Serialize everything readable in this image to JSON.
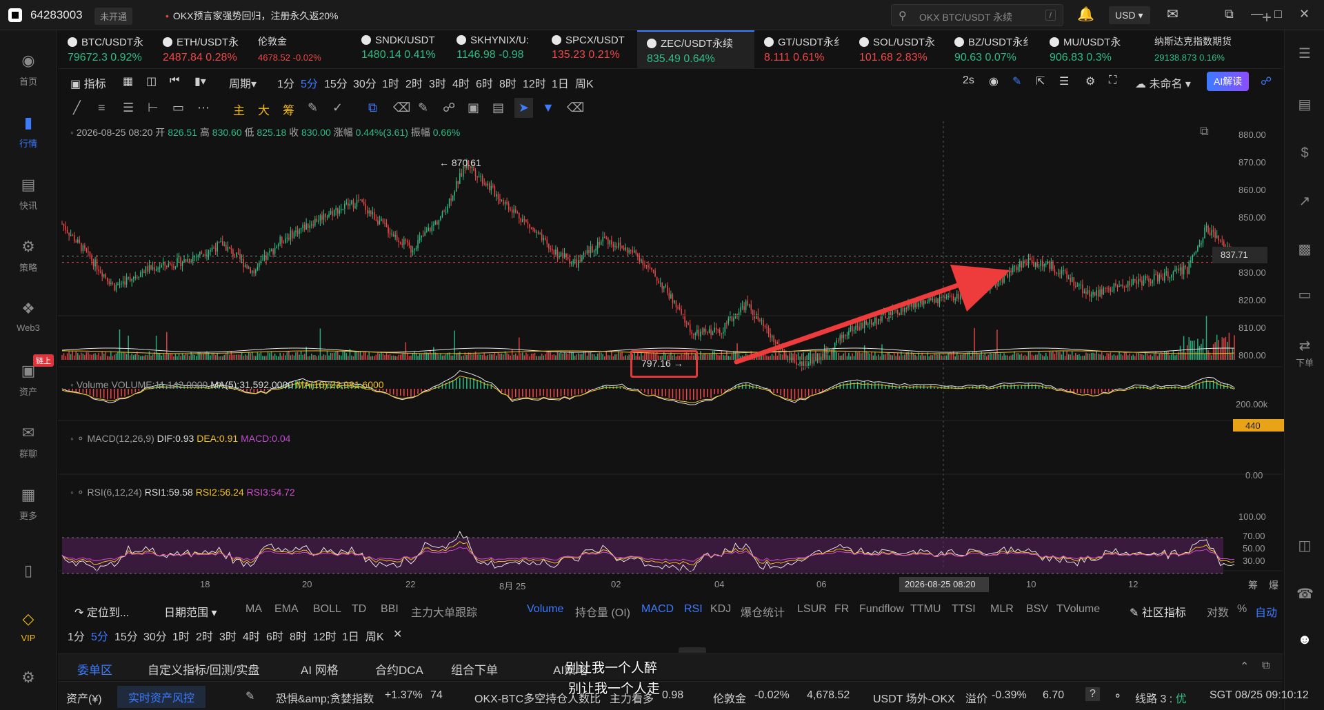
{
  "titlebar": {
    "uid": "64283003",
    "status": "未开通",
    "notice": "OKX预言家强势回归，注册永久返20%",
    "search_placeholder": "OKX BTC/USDT 永续",
    "search_shortcut": "/",
    "currency": "USD"
  },
  "sidebar": {
    "items": [
      {
        "label": "首页",
        "icon": "home-icon"
      },
      {
        "label": "行情",
        "icon": "market-icon"
      },
      {
        "label": "快讯",
        "icon": "news-icon"
      },
      {
        "label": "策略",
        "icon": "strategy-icon"
      },
      {
        "label": "Web3",
        "icon": "web3-icon"
      },
      {
        "label": "资产",
        "icon": "wallet-icon"
      },
      {
        "label": "群聊",
        "icon": "chat-icon"
      },
      {
        "label": "更多",
        "icon": "more-icon"
      },
      {
        "label": "VIP",
        "icon": "vip-icon"
      }
    ],
    "asset_badge": "链上"
  },
  "tabs": [
    {
      "name": "BTC/USDT永",
      "price": "79672.3",
      "change": "0.92%",
      "dir": "up"
    },
    {
      "name": "ETH/USDT永",
      "price": "2487.84",
      "change": "0.28%",
      "dir": "dn"
    },
    {
      "name": "伦敦金",
      "price": "4678.52",
      "change": "-0.02%",
      "dir": "dn",
      "small": true
    },
    {
      "name": "SNDK/USDT",
      "price": "1480.14",
      "change": "0.41%",
      "dir": "up"
    },
    {
      "name": "SKHYNIX/U:",
      "price": "1146.98",
      "change": "-0.98",
      "dir": "up"
    },
    {
      "name": "SPCX/USDT",
      "price": "135.23",
      "change": "0.21%",
      "dir": "dn"
    },
    {
      "name": "ZEC/USDT永续",
      "price": "835.49",
      "change": "0.64%",
      "dir": "up",
      "active": true
    },
    {
      "name": "GT/USDT永纟",
      "price": "8.111",
      "change": "0.61%",
      "dir": "dn"
    },
    {
      "name": "SOL/USDT永",
      "price": "101.68",
      "change": "2.83%",
      "dir": "dn"
    },
    {
      "name": "BZ/USDT永纟",
      "price": "90.63",
      "change": "0.07%",
      "dir": "up"
    },
    {
      "name": "MU/USDT永",
      "price": "906.83",
      "change": "0.3%",
      "dir": "up"
    },
    {
      "name": "纳斯达克指数期货",
      "price": "29138.873",
      "change": "0.16%",
      "dir": "up",
      "small": true
    }
  ],
  "toolbar": {
    "indicator": "指标",
    "period_label": "周期",
    "periods": [
      "1分",
      "5分",
      "15分",
      "30分",
      "1时",
      "2时",
      "3时",
      "4时",
      "6时",
      "8时",
      "12时",
      "1日",
      "周K"
    ],
    "selected_period": "5分",
    "refresh": "2s",
    "layout_name": "未命名",
    "ai_label": "AI解读"
  },
  "drawbar": {
    "zh_tools": [
      "主",
      "大",
      "筹"
    ]
  },
  "chart": {
    "ohlc_line": {
      "date": "2026-08-25 08:20",
      "open_label": "开",
      "open": "826.51",
      "high_label": "高",
      "high": "830.60",
      "low_label": "低",
      "low": "825.18",
      "close_label": "收",
      "close": "830.00",
      "chg_label": "涨幅",
      "chg": "0.44%(3.61)",
      "amp_label": "振幅",
      "amp": "0.66%"
    },
    "high_mark": "870.61",
    "low_mark": "797.16",
    "current_price": "837.71",
    "price_ticks": [
      "880.00",
      "870.00",
      "860.00",
      "850.00",
      "840.00",
      "830.00",
      "820.00",
      "810.00",
      "800.00"
    ],
    "volume": {
      "title": "Volume",
      "vol": "VOLUME:11,142.0000",
      "ma5": "MA(5):31,592.0000",
      "ma10": "MA(10):23,981.6000",
      "tick": "200.00k",
      "current": "440"
    },
    "macd": {
      "title": "MACD(12,26,9)",
      "dif": "DIF:0.93",
      "dea": "DEA:0.91",
      "macd": "MACD:0.04",
      "tick": "0.00"
    },
    "rsi": {
      "title": "RSI(6,12,24)",
      "rsi1": "RSI1:59.58",
      "rsi2": "RSI2:56.24",
      "rsi3": "RSI3:54.72",
      "ticks": [
        "100.00",
        "70.00",
        "50.00",
        "30.00"
      ]
    },
    "time_ticks": [
      "18",
      "20",
      "22",
      "8月 25",
      "02",
      "04",
      "06",
      "08",
      "10",
      "12"
    ],
    "crosshair_time": "2026-08-25 08:20",
    "corner_labels": [
      "筹",
      "爆"
    ]
  },
  "indicators": {
    "locate": "定位到...",
    "date_range": "日期范围",
    "main": [
      "MA",
      "EMA",
      "BOLL",
      "TD",
      "BBI",
      "主力大单跟踪"
    ],
    "sub": [
      "Volume",
      "持仓量 (OI)",
      "MACD",
      "RSI",
      "KDJ",
      "爆仓统计",
      "LSUR",
      "FR",
      "Fundflow",
      "TTMU",
      "TTSI",
      "MLR",
      "BSV",
      "TVolume"
    ],
    "on": [
      "Volume",
      "MACD",
      "RSI"
    ],
    "community": "社区指标",
    "log": "对数",
    "pct": "%",
    "auto": "自动"
  },
  "periodstrip": {
    "periods": [
      "1分",
      "5分",
      "15分",
      "30分",
      "1时",
      "2时",
      "3时",
      "4时",
      "6时",
      "8时",
      "12时",
      "1日",
      "周K"
    ],
    "selected": "5分"
  },
  "ordertabs": [
    "委单区",
    "自定义指标/回测/实盘",
    "AI 网格",
    "合约DCA",
    "组合下单",
    "AI策略"
  ],
  "subtitles": [
    "别让我一个人醉",
    "别让我一个人走"
  ],
  "statusbar": {
    "assets": "资产(¥)",
    "risk": "实时资产风控",
    "fear_label": "恐惧&amp;贪婪指数",
    "fear_chg": "+1.37%",
    "fear_val": "74",
    "ls_label": "OKX-BTC多空持仓人数比",
    "ls_note": "主力看多",
    "ls_val": "0.98",
    "gold_label": "伦敦金",
    "gold_chg": "-0.02%",
    "gold_val": "4,678.52",
    "usdt_label": "USDT 场外-OKX",
    "usdt_note": "溢价",
    "usdt_chg": "-0.39%",
    "usdt_val": "6.70",
    "line": "线路 3 :",
    "line_q": "优",
    "time": "SGT 08/25 09:10:12"
  },
  "chart_data": {
    "type": "candlestick",
    "y_range": [
      795,
      885
    ],
    "current_price": 837.71,
    "high": 870.61,
    "low": 797.16
  }
}
